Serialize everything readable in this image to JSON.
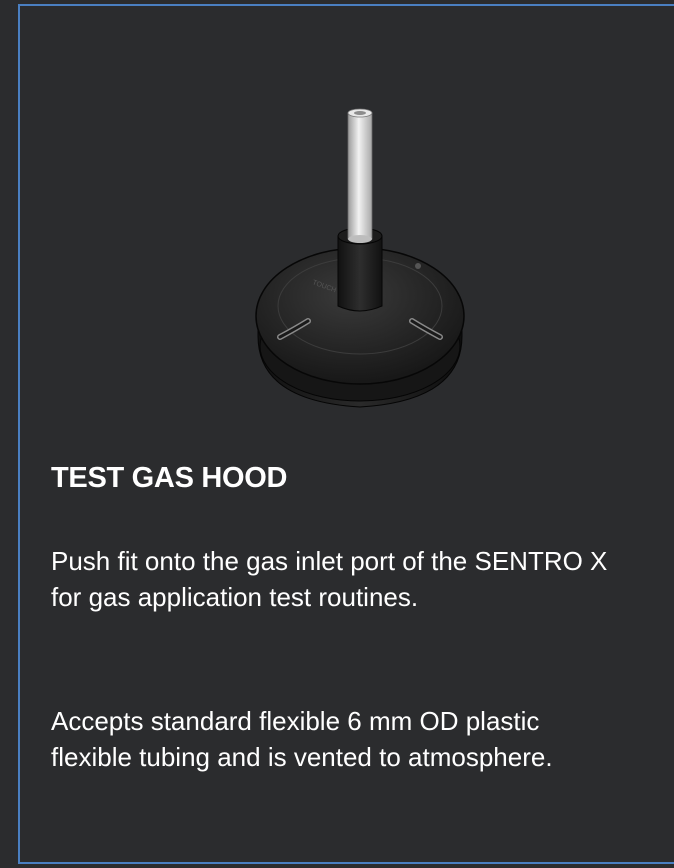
{
  "card": {
    "title": "TEST GAS HOOD",
    "paragraphs": [
      "Push fit onto the gas inlet port of the SENTRO X for gas application test routines.",
      "Accepts standard flexible 6 mm OD plastic flexible tubing and is vented to atmosphere."
    ],
    "image_icon": "test-gas-hood-product"
  },
  "colors": {
    "background": "#2b2c2e",
    "border": "#4a7fc1",
    "text": "#ffffff"
  }
}
